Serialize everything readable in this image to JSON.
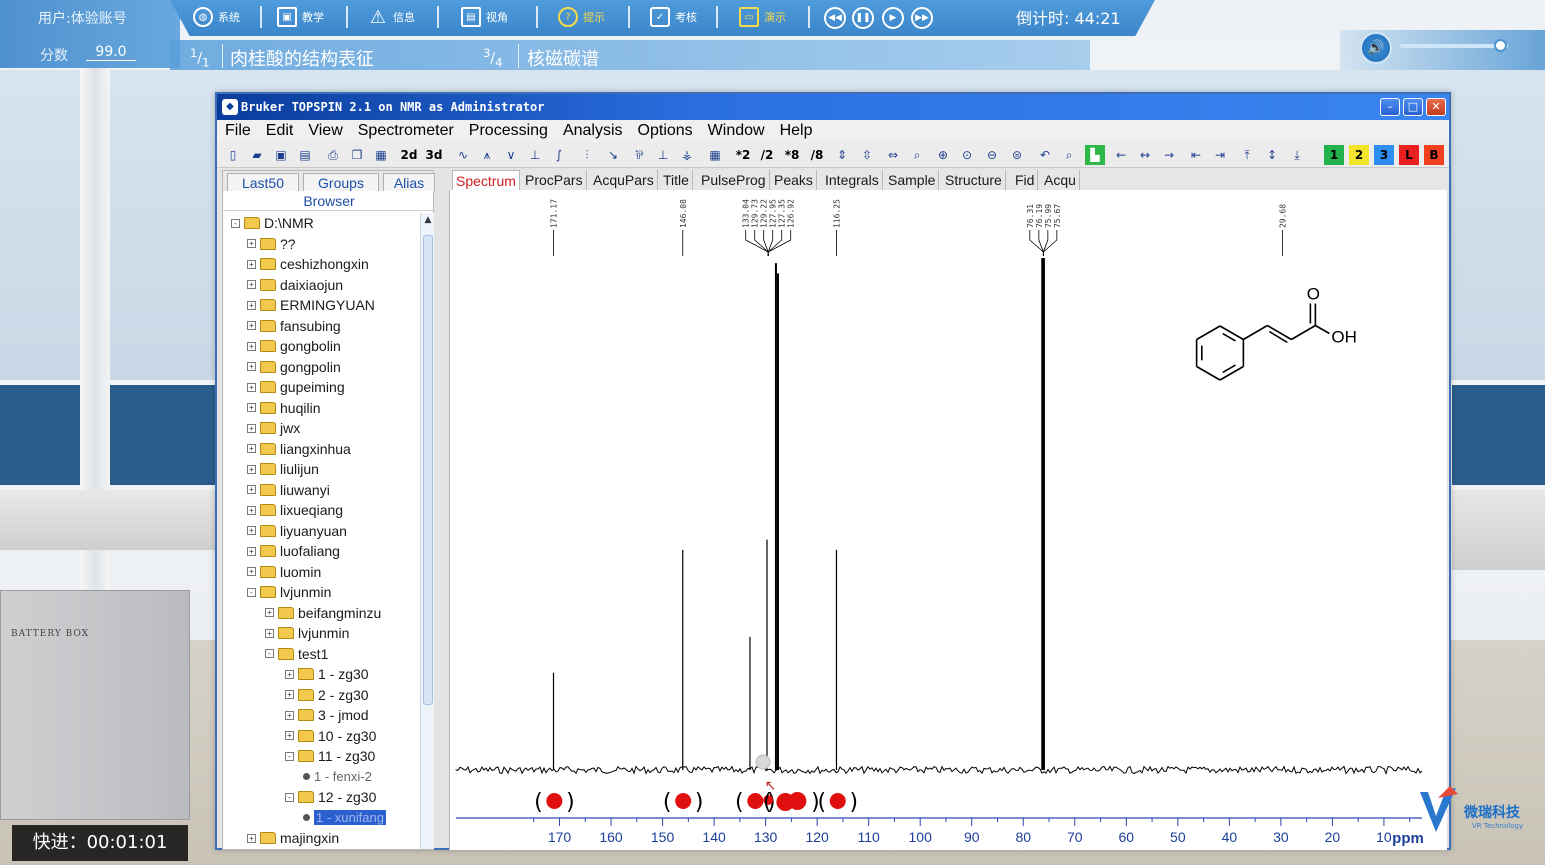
{
  "hud": {
    "user": "用户:体验账号",
    "score_label": "分数",
    "score_value": "99.0",
    "buttons": [
      {
        "label": "系统",
        "icon": "globe-icon"
      },
      {
        "label": "教学",
        "icon": "teach-icon"
      },
      {
        "label": "信息",
        "icon": "warning-icon"
      },
      {
        "label": "视角",
        "icon": "image-icon"
      },
      {
        "label": "提示",
        "icon": "question-icon"
      },
      {
        "label": "考核",
        "icon": "clipboard-check-icon"
      },
      {
        "label": "演示",
        "icon": "monitor-icon"
      }
    ],
    "timer": "倒计时: 44:21",
    "step1_frac_num": "1",
    "step1_frac_den": "1",
    "step1_title": "肉桂酸的结构表征",
    "step2_frac_num": "3",
    "step2_frac_den": "4",
    "step2_title": "核磁碳谱",
    "volume_level": 0.93
  },
  "window": {
    "title": "Bruker TOPSPIN 2.1 on NMR as Administrator",
    "menu": [
      "File",
      "Edit",
      "View",
      "Spectrometer",
      "Processing",
      "Analysis",
      "Options",
      "Window",
      "Help"
    ],
    "toolbar_text": [
      "2d",
      "3d",
      "*2",
      "/2",
      "*8",
      "/8"
    ],
    "color_buttons": [
      {
        "label": "1",
        "color": "#22b14c"
      },
      {
        "label": "2",
        "color": "#f5e52a"
      },
      {
        "label": "3",
        "color": "#2d8df0"
      },
      {
        "label": "L",
        "color": "#e82020"
      },
      {
        "label": "B",
        "color": "#f04020"
      }
    ]
  },
  "browser": {
    "tabs": [
      "Last50",
      "Groups",
      "Alias"
    ],
    "title": "Browser",
    "tree": [
      {
        "label": "D:\\NMR",
        "level": 0,
        "type": "folder",
        "sign": "-"
      },
      {
        "label": "??",
        "level": 1,
        "type": "folder",
        "sign": "+"
      },
      {
        "label": "ceshizhongxin",
        "level": 1,
        "type": "folder",
        "sign": "+"
      },
      {
        "label": "daixiaojun",
        "level": 1,
        "type": "folder",
        "sign": "+"
      },
      {
        "label": "ERMINGYUAN",
        "level": 1,
        "type": "folder",
        "sign": "+"
      },
      {
        "label": "fansubing",
        "level": 1,
        "type": "folder",
        "sign": "+"
      },
      {
        "label": "gongbolin",
        "level": 1,
        "type": "folder",
        "sign": "+"
      },
      {
        "label": "gongpolin",
        "level": 1,
        "type": "folder",
        "sign": "+"
      },
      {
        "label": "gupeiming",
        "level": 1,
        "type": "folder",
        "sign": "+"
      },
      {
        "label": "huqilin",
        "level": 1,
        "type": "folder",
        "sign": "+"
      },
      {
        "label": "jwx",
        "level": 1,
        "type": "folder",
        "sign": "+"
      },
      {
        "label": "liangxinhua",
        "level": 1,
        "type": "folder",
        "sign": "+"
      },
      {
        "label": "liulijun",
        "level": 1,
        "type": "folder",
        "sign": "+"
      },
      {
        "label": "liuwanyi",
        "level": 1,
        "type": "folder",
        "sign": "+"
      },
      {
        "label": "lixueqiang",
        "level": 1,
        "type": "folder",
        "sign": "+"
      },
      {
        "label": "liyuanyuan",
        "level": 1,
        "type": "folder",
        "sign": "+"
      },
      {
        "label": "luofaliang",
        "level": 1,
        "type": "folder",
        "sign": "+"
      },
      {
        "label": "luomin",
        "level": 1,
        "type": "folder",
        "sign": "+"
      },
      {
        "label": "lvjunmin",
        "level": 1,
        "type": "folder",
        "sign": "-"
      },
      {
        "label": "beifangminzu",
        "level": 2,
        "type": "folder",
        "sign": "+"
      },
      {
        "label": "lvjunmin",
        "level": 2,
        "type": "folder",
        "sign": "+"
      },
      {
        "label": "test1",
        "level": 2,
        "type": "folder",
        "sign": "-"
      },
      {
        "label": "1 - zg30",
        "level": 3,
        "type": "folder",
        "sign": "+"
      },
      {
        "label": "2 - zg30",
        "level": 3,
        "type": "folder",
        "sign": "+"
      },
      {
        "label": "3 - jmod",
        "level": 3,
        "type": "folder",
        "sign": "+"
      },
      {
        "label": "10 - zg30",
        "level": 3,
        "type": "folder",
        "sign": "+"
      },
      {
        "label": "11 - zg30",
        "level": 3,
        "type": "folder",
        "sign": "-"
      },
      {
        "label": "1 - fenxi-2",
        "level": 4,
        "type": "leaf",
        "sign": ""
      },
      {
        "label": "12 - zg30",
        "level": 3,
        "type": "folder",
        "sign": "-"
      },
      {
        "label": "1 - xunifang",
        "level": 4,
        "type": "leaf",
        "sign": "",
        "selected": true
      },
      {
        "label": "majingxin",
        "level": 1,
        "type": "folder",
        "sign": "+"
      }
    ]
  },
  "spectrum_tabs": [
    "Spectrum",
    "ProcPars",
    "AcquPars",
    "Title",
    "PulseProg",
    "Peaks",
    "Integrals",
    "Sample",
    "Structure",
    "Fid",
    "Acqu"
  ],
  "chart_data": {
    "type": "line",
    "xlabel": "ppm",
    "x_ticks": [
      170,
      160,
      150,
      140,
      130,
      120,
      110,
      100,
      90,
      80,
      70,
      60,
      50,
      40,
      30,
      20,
      10
    ],
    "xlim": [
      180,
      3
    ],
    "x_reversed": true,
    "peak_labels": [
      "171.17",
      "146.08",
      "133.04",
      "129.73",
      "129.22",
      "127.95",
      "127.35",
      "126.92",
      "116.25",
      "76.31",
      "76.19",
      "75.99",
      "75.67",
      "29.68"
    ],
    "peaks": [
      {
        "ppm": 171.17,
        "height": 0.19
      },
      {
        "ppm": 146.08,
        "height": 0.43
      },
      {
        "ppm": 133.04,
        "height": 0.26
      },
      {
        "ppm": 129.73,
        "height": 0.45
      },
      {
        "ppm": 128.0,
        "height": 0.99
      },
      {
        "ppm": 127.6,
        "height": 0.97
      },
      {
        "ppm": 116.25,
        "height": 0.43
      },
      {
        "ppm": 76.31,
        "height": 1.0
      },
      {
        "ppm": 75.99,
        "height": 1.0
      }
    ],
    "markers": [
      {
        "ppm": 171.0,
        "type": "bracket"
      },
      {
        "ppm": 146.0,
        "type": "bracket"
      },
      {
        "ppm": 132.0,
        "type": "bracket"
      },
      {
        "ppm": 129.5,
        "type": "dot"
      },
      {
        "ppm": 125.0,
        "type": "bracket-double"
      },
      {
        "ppm": 116.0,
        "type": "bracket"
      }
    ],
    "structure": {
      "substituent": "OH",
      "carbonyl": "O",
      "name_shown": false
    }
  },
  "speed": "快进：00:01:01",
  "brand": {
    "name": "微瑞科技",
    "sub": "VR Technology"
  }
}
